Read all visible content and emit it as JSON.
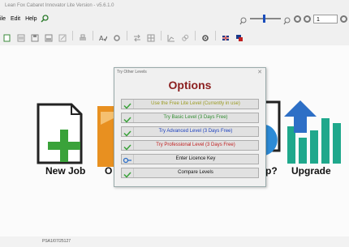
{
  "window": {
    "title": "Lean Fox Cabaret Innovator Lite Version - v5.6.1.0"
  },
  "menu": {
    "items": [
      "ile",
      "Edit",
      "Help"
    ]
  },
  "zoom": {
    "page_value": "1"
  },
  "status": {
    "text": "PSA1/07/25127"
  },
  "background": {
    "items": [
      {
        "label": "New Job"
      },
      {
        "label": "O"
      },
      {
        "label": "p?"
      },
      {
        "label": "Upgrade"
      }
    ]
  },
  "dialog": {
    "window_title": "Try Other Levels",
    "heading": "Options",
    "options": [
      {
        "label": "Use the Free Lite Level (Currently in use)",
        "color": "#9a9a20"
      },
      {
        "label": "Try Basic Level (3 Days Free)",
        "color": "#2e8b2e"
      },
      {
        "label": "Try Advanced Level (3 Days Free)",
        "color": "#1a3fbf"
      },
      {
        "label": "Try Professional Level (3 Days Free)",
        "color": "#c02020"
      },
      {
        "label": "Enter Licence Key",
        "color": "#111111"
      },
      {
        "label": "Compare Levels",
        "color": "#111111"
      }
    ]
  },
  "colors": {
    "green": "#3aa23a",
    "orange": "#e89020",
    "blue": "#2d8bd6",
    "teal": "#1fa88c"
  }
}
